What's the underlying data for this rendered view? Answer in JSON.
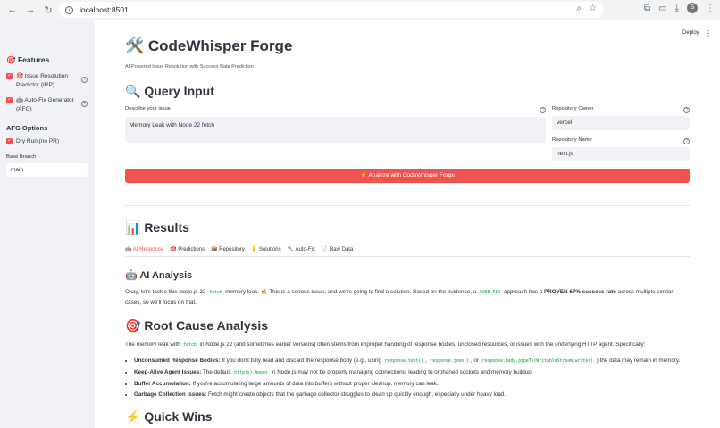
{
  "browser": {
    "url": "localhost:8501",
    "avatar_letter": "S"
  },
  "sidebar": {
    "features_title": "🎯 Features",
    "features": [
      {
        "label_line1": "🎯 Issue Resolution",
        "label_line2": "Predictor (IRP)",
        "checked": true
      },
      {
        "label_line1": "🤖 Auto-Fix Generator",
        "label_line2": "(AFG)",
        "checked": true
      }
    ],
    "afg_title": "AFG Options",
    "dry_run_label": "Dry Run (no PR)",
    "base_branch_label": "Base Branch",
    "base_branch_value": "main"
  },
  "header": {
    "deploy_label": "Deploy",
    "menu_icon": "⋮"
  },
  "main": {
    "title": "🛠️ CodeWhisper Forge",
    "subtitle": "AI-Powered Issue Resolution with Success Rate Prediction",
    "query_title": "🔍 Query Input",
    "describe_label": "Describe your issue",
    "describe_value": "Memory Leak with Node 22 fetch",
    "owner_label": "Repository Owner",
    "owner_value": "vercel",
    "repo_label": "Repository Name",
    "repo_value": "next.js",
    "analyze_button": "⚡ Analyze with CodeWhisper Forge",
    "results_title": "📊 Results",
    "tabs": [
      "🤖 AI Response",
      "🎯 Predictions",
      "📦 Repository",
      "💡 Solutions",
      "🔧 Auto-Fix",
      "📄 Raw Data"
    ],
    "ai_analysis_title": "🤖 AI Analysis",
    "ai_para": {
      "p1": "Okay, let's tackle this Node.js 22",
      "code1": "fetch",
      "p2": "memory leak. 🔥 This is a serious issue, and we're going to find a solution. Based on the evidence, a",
      "code2": "CODE FIX",
      "p3": "approach has a",
      "bold": "PROVEN 67% success rate",
      "p4": "across multiple similar cases, so we'll focus on that."
    },
    "root_cause_title": "🎯 Root Cause Analysis",
    "root_para": {
      "p1": "The memory leak with",
      "code1": "fetch",
      "p2": "in Node.js 22 (and sometimes earlier versions) often stems from improper handling of response bodies, unclosed resources, or issues with the underlying HTTP agent. Specifically:"
    },
    "bullets": [
      {
        "bold": "Unconsumed Response Bodies:",
        "text": "If you don't fully read and discard the response body (e.g., using",
        "code1": "response.text()",
        "sep1": ",",
        "code2": "response.json()",
        "sep2": ", or",
        "code3": "response.body.pipeTo(WritableStream.writer)",
        "tail": ") the data may remain in memory."
      },
      {
        "bold": "Keep-Alive Agent Issues:",
        "text": "The default",
        "code1": "http(s).Agent",
        "tail": "in Node.js may not be properly managing connections, leading to orphaned sockets and memory buildup."
      },
      {
        "bold": "Buffer Accumulation:",
        "text": "If you're accumulating large amounts of data into buffers without proper cleanup, memory can leak."
      },
      {
        "bold": "Garbage Collection Issues:",
        "text": "Fetch might create objects that the garbage collector struggles to clean up quickly enough, especially under heavy load."
      }
    ],
    "quick_wins_title": "⚡ Quick Wins"
  }
}
